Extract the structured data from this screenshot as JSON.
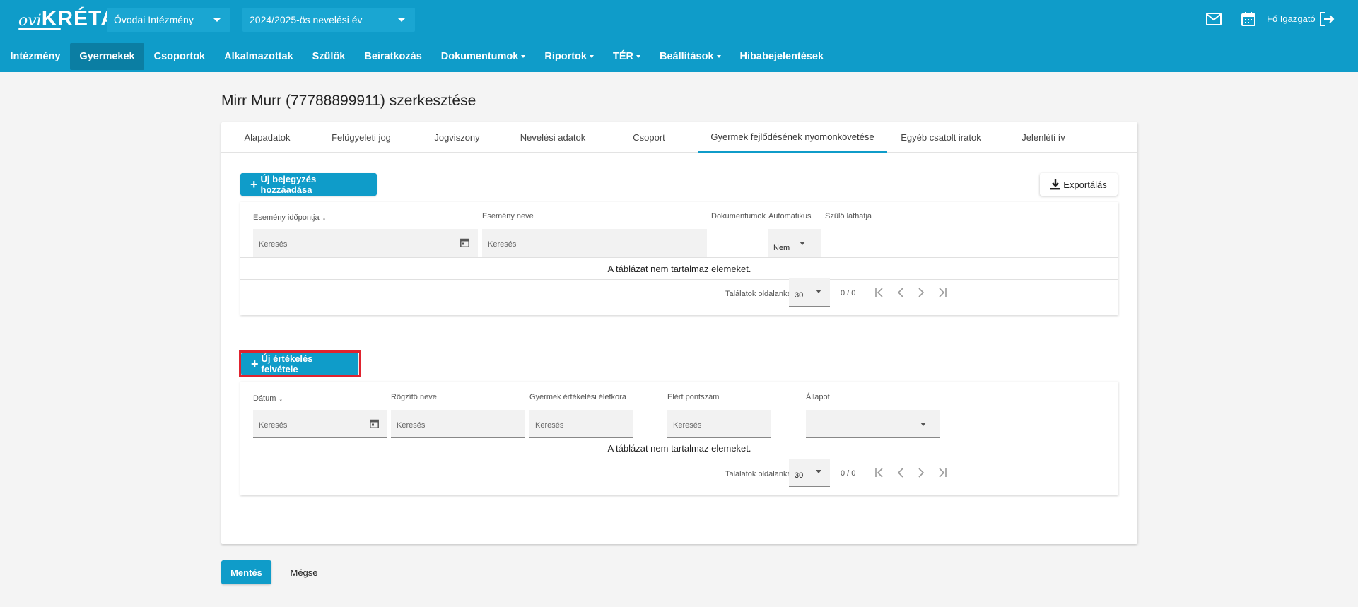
{
  "header": {
    "logo_ovi": "ovi",
    "logo_kreta": "KRÉTA",
    "institution_select": "Óvodai Intézmény",
    "year_select": "2024/2025-ös nevelési év",
    "user_name": "Fő Igazgató",
    "icons": [
      "mail-icon",
      "calendar-icon",
      "logout-icon"
    ]
  },
  "nav": {
    "items": [
      {
        "label": "Intézmény",
        "dropdown": false
      },
      {
        "label": "Gyermekek",
        "dropdown": false,
        "active": true
      },
      {
        "label": "Csoportok",
        "dropdown": false
      },
      {
        "label": "Alkalmazottak",
        "dropdown": false
      },
      {
        "label": "Szülők",
        "dropdown": false
      },
      {
        "label": "Beiratkozás",
        "dropdown": false
      },
      {
        "label": "Dokumentumok",
        "dropdown": true
      },
      {
        "label": "Riportok",
        "dropdown": true
      },
      {
        "label": "TÉR",
        "dropdown": true
      },
      {
        "label": "Beállítások",
        "dropdown": true
      },
      {
        "label": "Hibabejelentések",
        "dropdown": false
      }
    ]
  },
  "page": {
    "title": "Mirr Murr (77788899911) szerkesztése"
  },
  "tabs": [
    "Alapadatok",
    "Felügyeleti jog",
    "Jogviszony",
    "Nevelési adatok",
    "Csoport",
    "Gyermek fejlődésének nyomonkövetése",
    "Egyéb csatolt iratok",
    "Jelenléti ív"
  ],
  "active_tab": "Gyermek fejlődésének nyomonkövetése",
  "section1": {
    "add_button": "Új bejegyzés hozzáadása",
    "export_button": "Exportálás",
    "columns": {
      "date": "Esemény időpontja",
      "name": "Esemény neve",
      "docs": "Dokumentumok",
      "auto": "Automatikus",
      "parent": "Szülő láthatja"
    },
    "filters": {
      "date_placeholder": "Keresés",
      "name_placeholder": "Keresés",
      "auto_value": "Nem"
    },
    "empty_text": "A táblázat nem tartalmaz elemeket.",
    "pager": {
      "label": "Találatok oldalanként",
      "page_size": "30",
      "count": "0 / 0"
    }
  },
  "section2": {
    "add_button": "Új értékelés felvétele",
    "columns": {
      "date": "Dátum",
      "recorder": "Rögzítő neve",
      "age": "Gyermek értékelési életkora",
      "score": "Elért pontszám",
      "status": "Állapot"
    },
    "filters": {
      "date_placeholder": "Keresés",
      "recorder_placeholder": "Keresés",
      "age_placeholder": "Keresés",
      "score_placeholder": "Keresés",
      "status_value": ""
    },
    "empty_text": "A táblázat nem tartalmaz elemeket.",
    "pager": {
      "label": "Találatok oldalanként",
      "page_size": "30",
      "count": "0 / 0"
    }
  },
  "footer": {
    "save": "Mentés",
    "cancel": "Mégse"
  },
  "colors": {
    "primary": "#0f9cc9",
    "nav_active": "#0b7ea3",
    "highlight": "#e0232f"
  }
}
